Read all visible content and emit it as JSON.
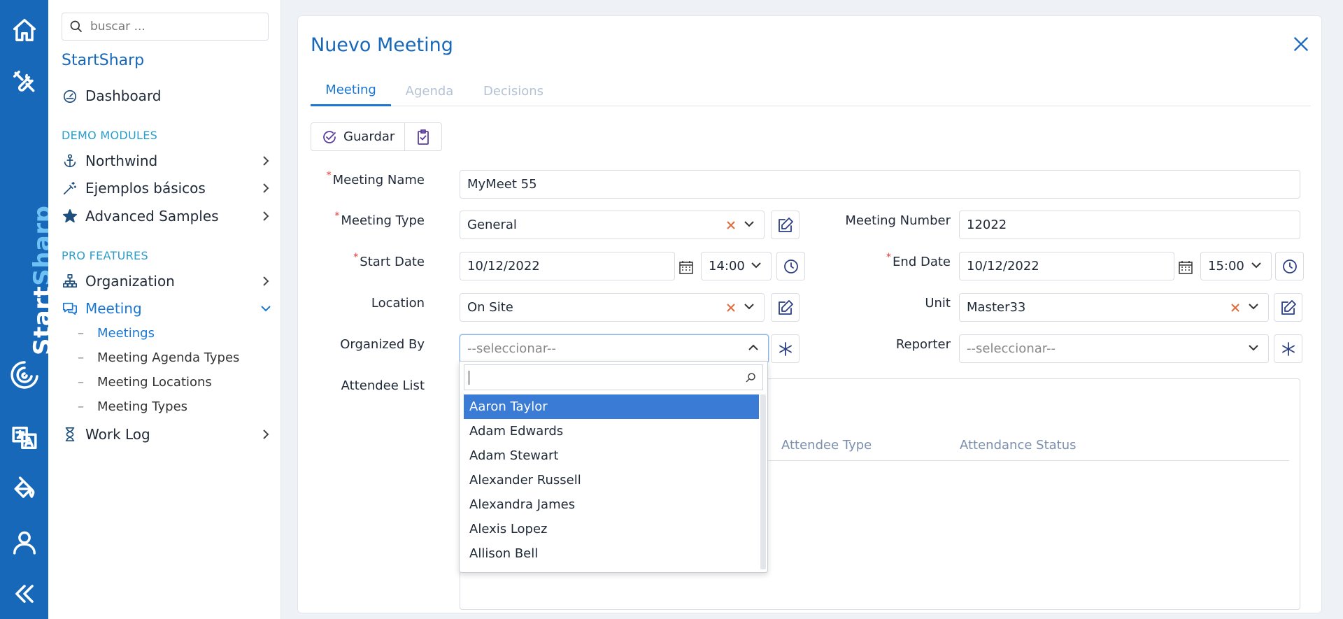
{
  "rail": {
    "brand_start": "Start",
    "brand_sharp": "Sharp",
    "icons": [
      "home-icon",
      "tools-icon",
      "translate-icon",
      "paint-bucket-icon",
      "user-icon",
      "collapse-icon"
    ]
  },
  "sidebar": {
    "search_placeholder": "buscar ...",
    "app_title": "StartSharp",
    "dashboard": "Dashboard",
    "section_demo": "DEMO MODULES",
    "northwind": "Northwind",
    "ejemplos": "Ejemplos básicos",
    "advanced": "Advanced Samples",
    "section_pro": "PRO FEATURES",
    "organization": "Organization",
    "meeting": "Meeting",
    "sub": [
      "Meetings",
      "Meeting Agenda Types",
      "Meeting Locations",
      "Meeting Types"
    ],
    "worklog": "Work Log"
  },
  "dialog": {
    "title": "Nuevo Meeting",
    "tabs": [
      "Meeting",
      "Agenda",
      "Decisions"
    ],
    "save_label": "Guardar",
    "labels": {
      "meeting_name": "Meeting Name",
      "meeting_type": "Meeting Type",
      "meeting_number": "Meeting Number",
      "start_date": "Start Date",
      "end_date": "End Date",
      "location": "Location",
      "unit": "Unit",
      "organized_by": "Organized By",
      "reporter": "Reporter",
      "attendee_list": "Attendee List"
    },
    "values": {
      "meeting_name": "MyMeet 55",
      "meeting_type": "General",
      "meeting_number": "12022",
      "start_date": "10/12/2022",
      "start_time": "14:00",
      "end_date": "10/12/2022",
      "end_time": "15:00",
      "location": "On Site",
      "unit": "Master33",
      "organized_by_placeholder": "--seleccionar--",
      "reporter_placeholder": "--seleccionar--"
    },
    "grid_columns": [
      "Attendee Type",
      "Attendance Status"
    ],
    "dropdown_options": [
      "Aaron Taylor",
      "Adam Edwards",
      "Adam Stewart",
      "Alexander Russell",
      "Alexandra James",
      "Alexis Lopez",
      "Allison Bell"
    ]
  },
  "colors": {
    "rail": "#1768b9",
    "accent": "#1976d2",
    "selected_option": "#3a7bd5",
    "required": "#e53935"
  }
}
